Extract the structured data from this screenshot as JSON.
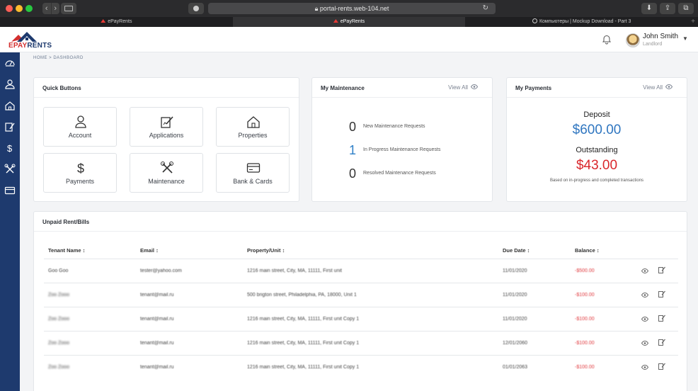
{
  "browser": {
    "url": "portal-rents.web-104.net",
    "tabs": [
      {
        "title": "ePayRents",
        "active": false
      },
      {
        "title": "ePayRents",
        "active": true
      },
      {
        "title": "Компьютеры | Mockup Download - Part 3",
        "active": false
      }
    ]
  },
  "app": {
    "brand": {
      "e": "E",
      "pay": "PAY",
      "rents": "RENTS"
    },
    "user": {
      "name": "John Smith",
      "role": "Landlord"
    },
    "breadcrumb": "HOME > DASHBOARD",
    "sidebar": [
      {
        "icon": "dashboard-gauge-icon"
      },
      {
        "icon": "user-icon"
      },
      {
        "icon": "home-icon"
      },
      {
        "icon": "edit-document-icon"
      },
      {
        "icon": "dollar-icon"
      },
      {
        "icon": "tools-icon"
      },
      {
        "icon": "credit-card-icon"
      }
    ]
  },
  "quick_buttons": {
    "title": "Quick Buttons",
    "items": [
      {
        "label": "Account",
        "icon": "user-icon"
      },
      {
        "label": "Applications",
        "icon": "edit-document-icon"
      },
      {
        "label": "Properties",
        "icon": "home-icon"
      },
      {
        "label": "Payments",
        "icon": "dollar-icon"
      },
      {
        "label": "Maintenance",
        "icon": "tools-icon"
      },
      {
        "label": "Bank & Cards",
        "icon": "credit-card-icon"
      }
    ]
  },
  "maintenance": {
    "title": "My Maintenance",
    "view_all": "View All",
    "rows": [
      {
        "count": "0",
        "label": "New Maintenance Requests"
      },
      {
        "count": "1",
        "label": "In Progress Maintenance Requests"
      },
      {
        "count": "0",
        "label": "Resolved Maintenance Requests"
      }
    ]
  },
  "payments": {
    "title": "My Payments",
    "view_all": "View All",
    "deposit_label": "Deposit",
    "deposit_amount": "$600.00",
    "outstanding_label": "Outstanding",
    "outstanding_amount": "$43.00",
    "note": "Based on in-progress and completed transactions"
  },
  "bills": {
    "title": "Unpaid Rent/Bills",
    "columns": [
      "Tenant Name ↕",
      "Email ↕",
      "Property/Unit ↕",
      "Due Date ↕",
      "Balance ↕"
    ],
    "rows": [
      [
        "Goo Goo",
        "tester@yahoo.com",
        "1216 main street, City, MA, 11111, First unit",
        "11/01/2020",
        "-$500.00"
      ],
      [
        "Zoo Zooo",
        "tenant@mail.ru",
        "500 brigton street, Philadelphia, PA, 18000, Unit 1",
        "11/01/2020",
        "-$100.00"
      ],
      [
        "Zoo Zooo",
        "tenant@mail.ru",
        "1216 main street, City, MA, 11111, First unit Copy 1",
        "11/01/2020",
        "-$100.00"
      ],
      [
        "Zoo Zooo",
        "tenant@mail.ru",
        "1216 main street, City, MA, 11111, First unit Copy 1",
        "12/01/2060",
        "-$100.00"
      ],
      [
        "Zoo Zooo",
        "tenant@mail.ru",
        "1216 main street, City, MA, 11111, First unit Copy 1",
        "01/01/2063",
        "-$100.00"
      ]
    ]
  }
}
